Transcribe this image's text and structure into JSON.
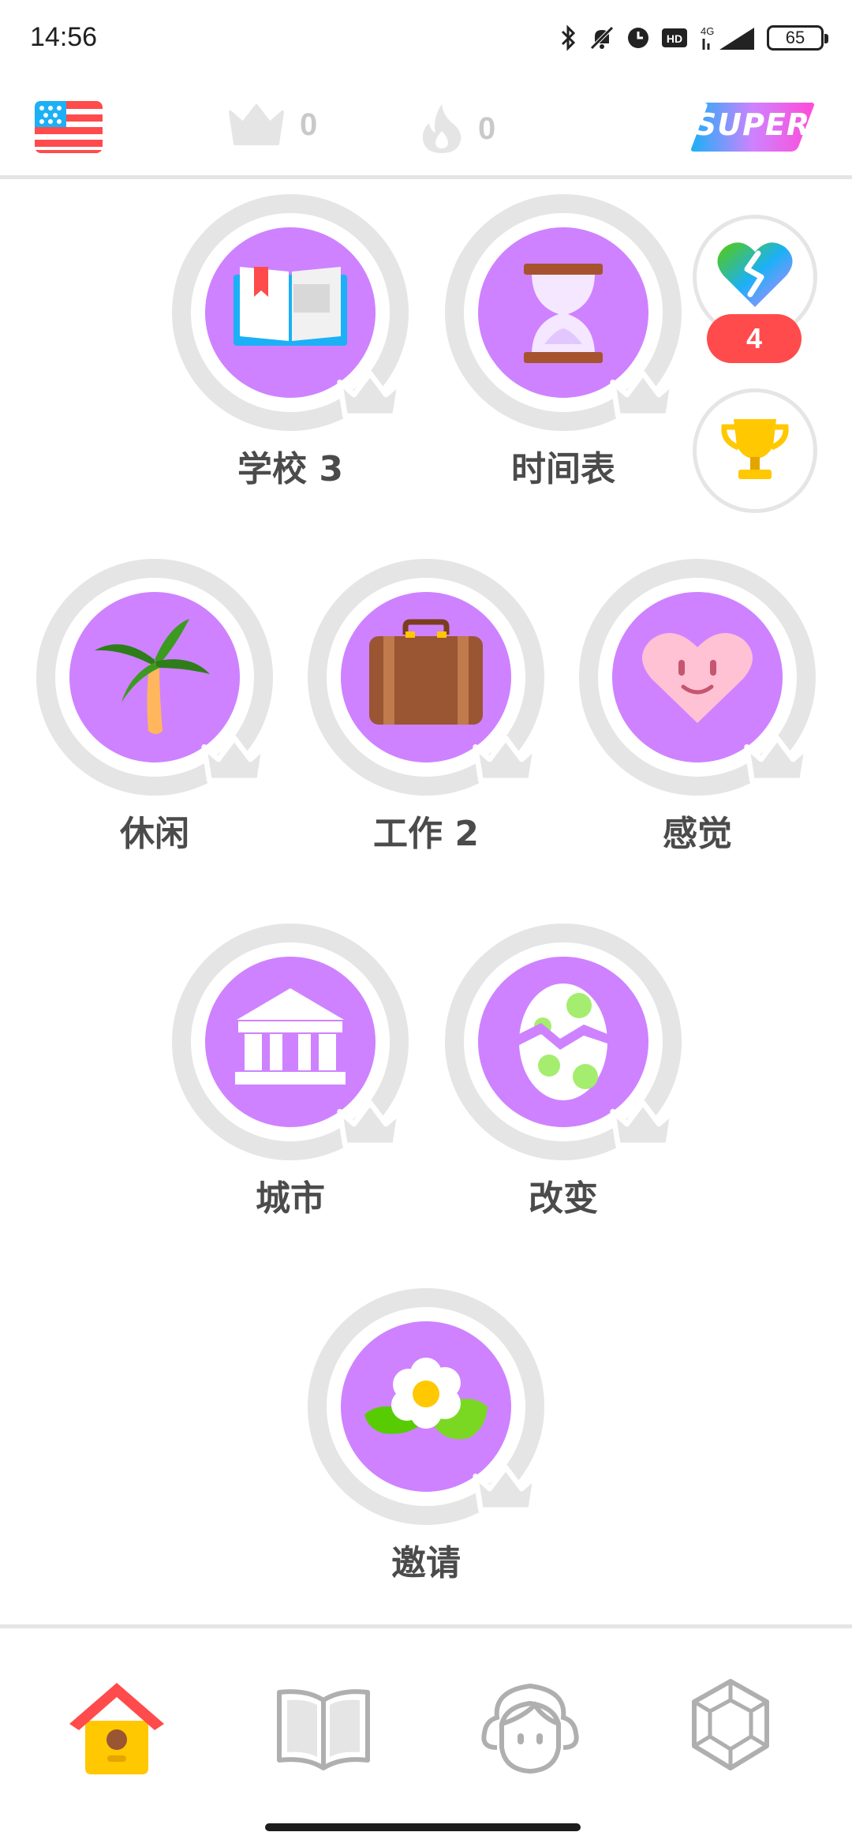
{
  "status_bar": {
    "time": "14:56",
    "network": "4G",
    "battery": "65"
  },
  "header": {
    "course_flag": "us-flag-icon",
    "crowns": "0",
    "streak": "0",
    "super_label": "SUPER"
  },
  "skills": [
    {
      "label": "学校 3",
      "icon": "book-icon"
    },
    {
      "label": "时间表",
      "icon": "hourglass-icon"
    },
    {
      "label": "休闲",
      "icon": "palm-tree-icon"
    },
    {
      "label": "工作 2",
      "icon": "suitcase-icon"
    },
    {
      "label": "感觉",
      "icon": "heart-face-icon"
    },
    {
      "label": "城市",
      "icon": "building-icon"
    },
    {
      "label": "改变",
      "icon": "egg-icon"
    },
    {
      "label": "邀请",
      "icon": "flower-icon"
    }
  ],
  "side": {
    "hearts_count": "4"
  },
  "bottom_nav": [
    {
      "name": "home",
      "icon": "birdhouse-icon",
      "active": true
    },
    {
      "name": "stories",
      "icon": "open-book-icon",
      "active": false
    },
    {
      "name": "profile",
      "icon": "avatar-icon",
      "active": false
    },
    {
      "name": "shop",
      "icon": "gem-icon",
      "active": false
    }
  ],
  "colors": {
    "skill_purple": "#ce82ff",
    "ring_gray": "#e5e5e5",
    "heart_red": "#ff4b4b",
    "text_dark": "#4b4b4b"
  }
}
